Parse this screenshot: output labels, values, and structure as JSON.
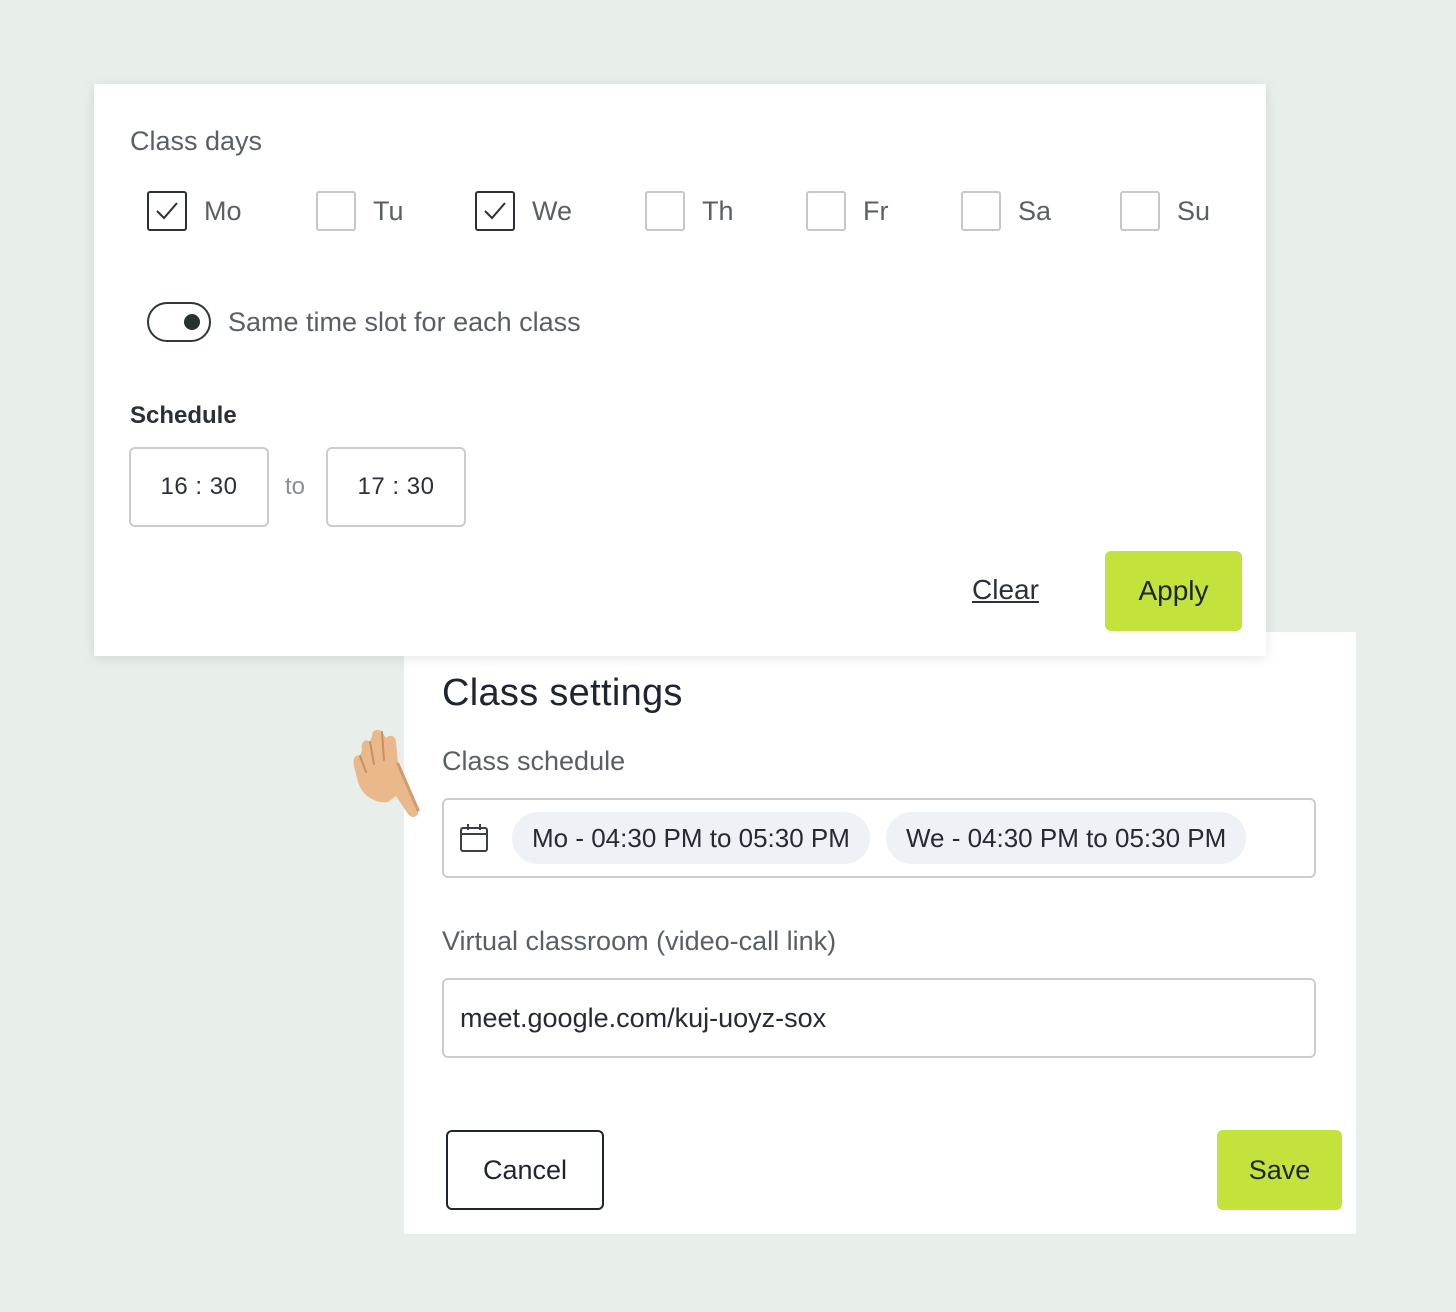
{
  "class_days": {
    "label": "Class days",
    "days": [
      {
        "label": "Mo",
        "checked": true
      },
      {
        "label": "Tu",
        "checked": false
      },
      {
        "label": "We",
        "checked": true
      },
      {
        "label": "Th",
        "checked": false
      },
      {
        "label": "Fr",
        "checked": false
      },
      {
        "label": "Sa",
        "checked": false
      },
      {
        "label": "Su",
        "checked": false
      }
    ],
    "same_slot_toggle": {
      "label": "Same time slot for each class",
      "on": true
    },
    "schedule_label": "Schedule",
    "start_time": "16 : 30",
    "to_label": "to",
    "end_time": "17 : 30",
    "clear_label": "Clear",
    "apply_label": "Apply"
  },
  "class_settings": {
    "title": "Class settings",
    "schedule_label": "Class schedule",
    "schedule_icon": "calendar-icon",
    "schedule_chips": [
      "Mo - 04:30 PM to 05:30 PM",
      "We - 04:30 PM to 05:30 PM"
    ],
    "virtual_label": "Virtual classroom (video-call link)",
    "virtual_link": "meet.google.com/kuj-uoyz-sox",
    "cancel_label": "Cancel",
    "save_label": "Save"
  },
  "colors": {
    "background": "#e8eeea",
    "accent": "#c3e23c",
    "text_dark": "#1e2431"
  }
}
